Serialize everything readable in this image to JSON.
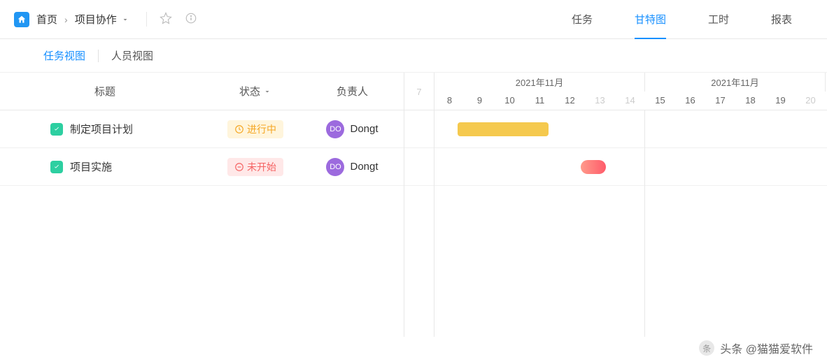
{
  "breadcrumb": {
    "home": "首页",
    "project": "项目协作"
  },
  "nav": {
    "tabs": [
      "任务",
      "甘特图",
      "工时",
      "报表"
    ],
    "active_index": 1
  },
  "sub_nav": {
    "tabs": [
      "任务视图",
      "人员视图"
    ],
    "active_index": 0
  },
  "table": {
    "headers": {
      "title": "标题",
      "status": "状态",
      "owner": "负责人"
    },
    "rows": [
      {
        "title": "制定项目计划",
        "status_text": "进行中",
        "status_type": "in-progress",
        "owner_initials": "DO",
        "owner_name": "Dongt"
      },
      {
        "title": "项目实施",
        "status_text": "未开始",
        "status_type": "not-started",
        "owner_initials": "DO",
        "owner_name": "Dongt"
      }
    ]
  },
  "gantt": {
    "lead_days": [
      "7"
    ],
    "months": [
      {
        "label": "2021年11月",
        "days": [
          "8",
          "9",
          "10",
          "11",
          "12",
          "13",
          "14"
        ],
        "weekend": [
          5,
          6
        ]
      },
      {
        "label": "2021年11月",
        "days": [
          "15",
          "16",
          "17",
          "18",
          "19",
          "20"
        ],
        "weekend": [
          5
        ]
      }
    ]
  },
  "chart_data": {
    "type": "gantt",
    "title": "甘特图",
    "time_unit": "day",
    "visible_range": [
      "2021-11-07",
      "2021-11-20"
    ],
    "tasks": [
      {
        "name": "制定项目计划",
        "start": "2021-11-08",
        "end": "2021-11-11",
        "status": "进行中",
        "color": "#f5c94e",
        "owner": "Dongt"
      },
      {
        "name": "项目实施",
        "start": "2021-11-13",
        "end": "2021-11-13",
        "status": "未开始",
        "color": "#ff5b6a",
        "owner": "Dongt"
      }
    ]
  },
  "watermark": {
    "text": "头条 @猫猫爱软件"
  }
}
